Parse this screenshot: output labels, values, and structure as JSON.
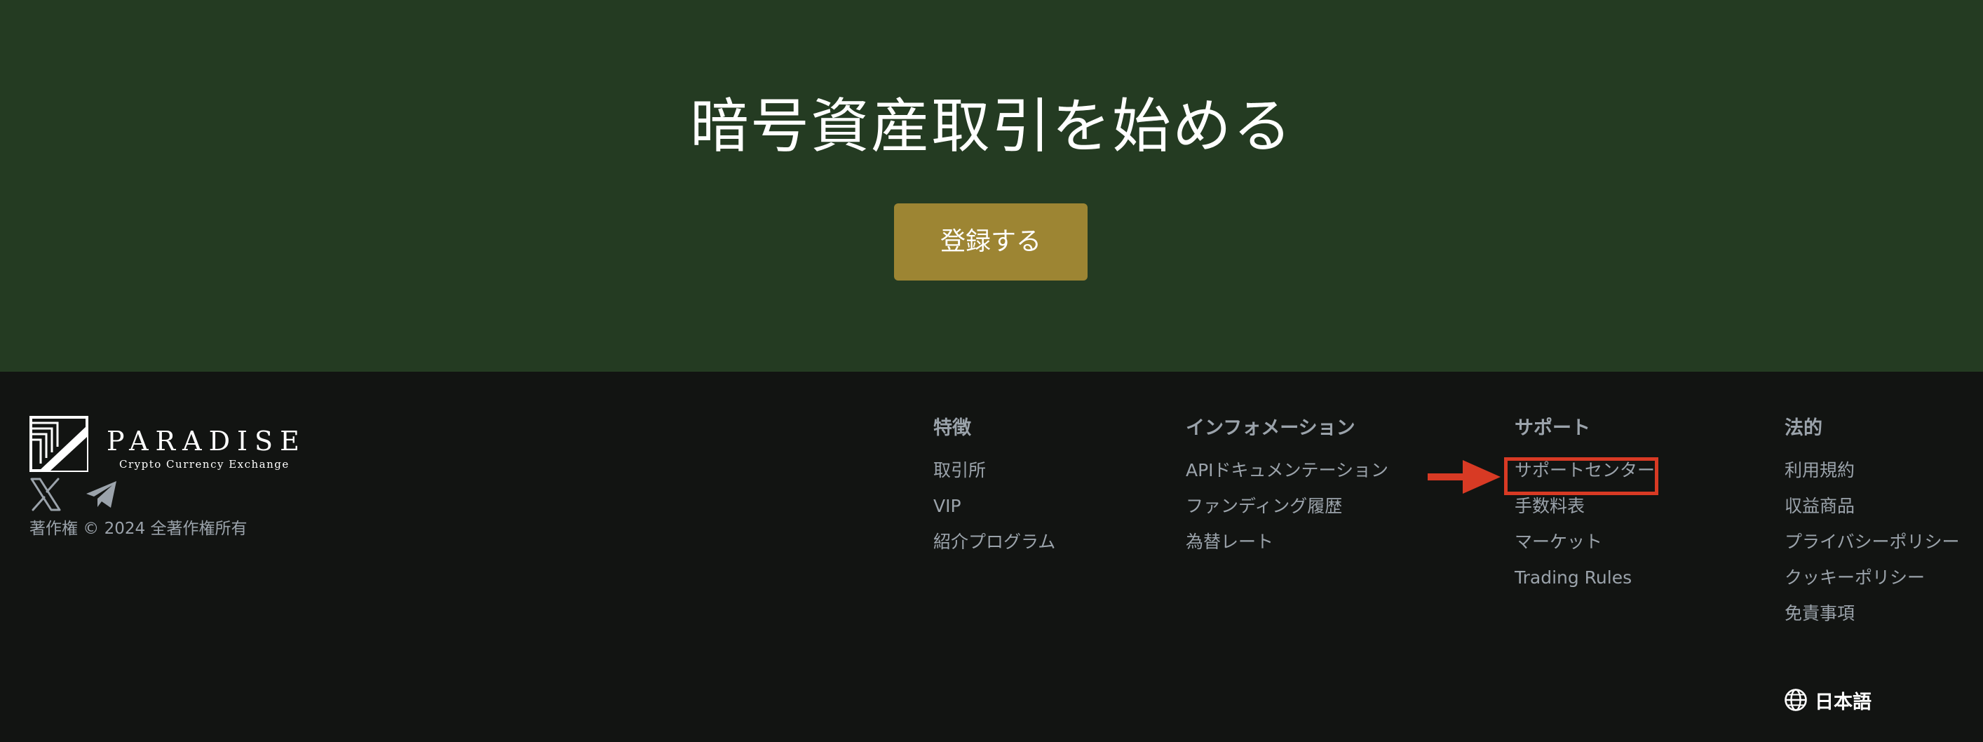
{
  "hero": {
    "title": "暗号資産取引を始める",
    "register_label": "登録する"
  },
  "brand": {
    "name": "PARADISE",
    "tagline": "Crypto Currency Exchange",
    "copyright": "著作権 © 2024 全著作権所有"
  },
  "social": [
    {
      "icon": "x-icon"
    },
    {
      "icon": "telegram-icon"
    }
  ],
  "footer": {
    "columns": [
      {
        "heading": "特徴",
        "links": [
          "取引所",
          "VIP",
          "紹介プログラム"
        ]
      },
      {
        "heading": "インフォメーション",
        "links": [
          "APIドキュメンテーション",
          "ファンディング履歴",
          "為替レート"
        ]
      },
      {
        "heading": "サポート",
        "links": [
          "サポートセンター",
          "手数料表",
          "マーケット",
          "Trading Rules"
        ]
      },
      {
        "heading": "法的",
        "links": [
          "利用規約",
          "収益商品",
          "プライバシーポリシー",
          "クッキーポリシー",
          "免責事項"
        ]
      }
    ]
  },
  "language": {
    "icon": "globe-icon",
    "label": "日本語"
  },
  "colors": {
    "hero_bg": "#243b22",
    "footer_bg": "#121412",
    "button_bg": "#9d8533",
    "link_text": "#9ba3ab",
    "annotation": "#d83a24"
  }
}
